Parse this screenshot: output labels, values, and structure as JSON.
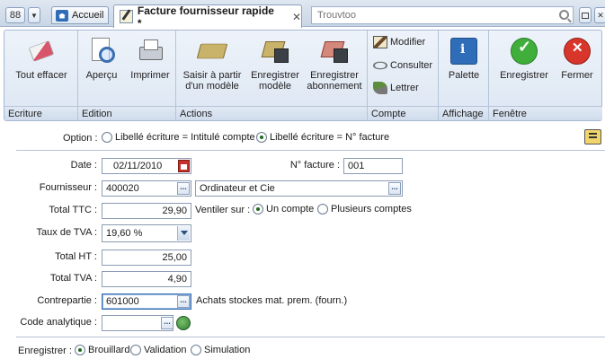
{
  "tabbar": {
    "grid_glyph": "88",
    "home_label": "Accueil",
    "active_tab_label": "Facture fournisseur rapide *",
    "search_placeholder": "Trouvtoo"
  },
  "ribbon": {
    "groups": [
      {
        "label": "Ecriture",
        "buttons": [
          {
            "label": "Tout effacer",
            "icon": "eraser-icon"
          }
        ]
      },
      {
        "label": "Edition",
        "buttons": [
          {
            "label": "Aperçu",
            "icon": "preview-icon"
          },
          {
            "label": "Imprimer",
            "icon": "printer-icon"
          }
        ]
      },
      {
        "label": "Actions",
        "buttons": [
          {
            "label_line1": "Saisir à partir",
            "label_line2": "d'un modèle",
            "icon": "book-icon"
          },
          {
            "label_line1": "Enregistrer",
            "label_line2": "modèle",
            "icon": "save-model-icon"
          },
          {
            "label_line1": "Enregistrer",
            "label_line2": "abonnement",
            "icon": "save-subscription-icon"
          }
        ]
      },
      {
        "label": "Compte",
        "buttons": [
          {
            "label": "Modifier",
            "icon": "edit-icon"
          },
          {
            "label": "Consulter",
            "icon": "view-icon"
          },
          {
            "label": "Lettrer",
            "icon": "letter-icon"
          }
        ]
      },
      {
        "label": "Affichage",
        "buttons": [
          {
            "label": "Palette",
            "icon": "palette-icon"
          }
        ]
      },
      {
        "label": "Fenêtre",
        "buttons": [
          {
            "label": "Enregistrer",
            "icon": "save-ok-icon"
          },
          {
            "label": "Fermer",
            "icon": "close-icon"
          }
        ]
      }
    ]
  },
  "form": {
    "option_label": "Option :",
    "option_a": "Libellé écriture = Intitulé compte",
    "option_b": "Libellé écriture = N° facture",
    "option_selected": "b",
    "date_label": "Date :",
    "date_value": "02/11/2010",
    "invoice_label": "N° facture :",
    "invoice_value": "001",
    "supplier_label": "Fournisseur :",
    "supplier_code": "400020",
    "supplier_name": "Ordinateur et Cie",
    "ttc_label": "Total TTC :",
    "ttc_value": "29,90",
    "ventiler_label": "Ventiler sur :",
    "ventiler_a": "Un compte",
    "ventiler_b": "Plusieurs comptes",
    "vat_rate_label": "Taux de TVA :",
    "vat_rate_value": "19,60 %",
    "ht_label": "Total HT :",
    "ht_value": "25,00",
    "tva_label": "Total TVA :",
    "tva_value": "4,90",
    "contrepartie_label": "Contrepartie :",
    "contrepartie_value": "601000",
    "contrepartie_desc": "Achats stockes mat. prem. (fourn.)",
    "analytic_label": "Code analytique :",
    "analytic_value": "",
    "save_mode_label": "Enregistrer :",
    "save_modes": [
      "Brouillard",
      "Validation",
      "Simulation"
    ],
    "save_mode_selected": "Brouillard",
    "ellipsis": "..."
  },
  "colors": {
    "accent": "#2f6db8",
    "ok": "#3fae3a",
    "close": "#d9362b"
  }
}
